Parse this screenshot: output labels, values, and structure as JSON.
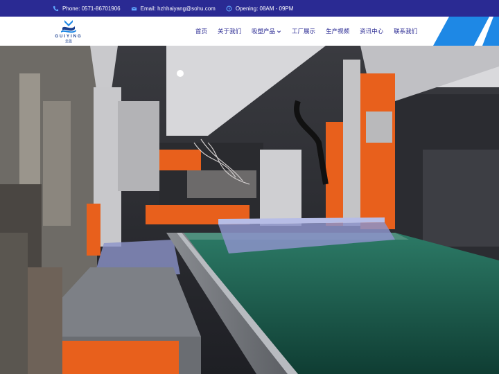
{
  "topbar": {
    "phone": "Phone: 0571-86701906",
    "email": "Email: hzhhaiyang@sohu.com",
    "opening": "Opening: 08AM - 09PM"
  },
  "logo": {
    "brand": "GUIYING",
    "sub": "圭盈"
  },
  "nav": {
    "items": [
      {
        "label": "首页"
      },
      {
        "label": "关于我们"
      },
      {
        "label": "吸塑产品",
        "has_dropdown": true
      },
      {
        "label": "工厂展示"
      },
      {
        "label": "生产视频"
      },
      {
        "label": "资讯中心"
      },
      {
        "label": "联系我们"
      }
    ]
  },
  "colors": {
    "topbar_bg": "#2a2a93",
    "nav_text": "#2a2a93",
    "accent_blue": "#1e88e5",
    "machine_orange": "#e8601c",
    "conveyor_green": "#1f6b55"
  },
  "icons": {
    "phone": "phone-icon",
    "email": "envelope-icon",
    "opening": "clock-icon",
    "dropdown": "chevron-down-icon"
  }
}
